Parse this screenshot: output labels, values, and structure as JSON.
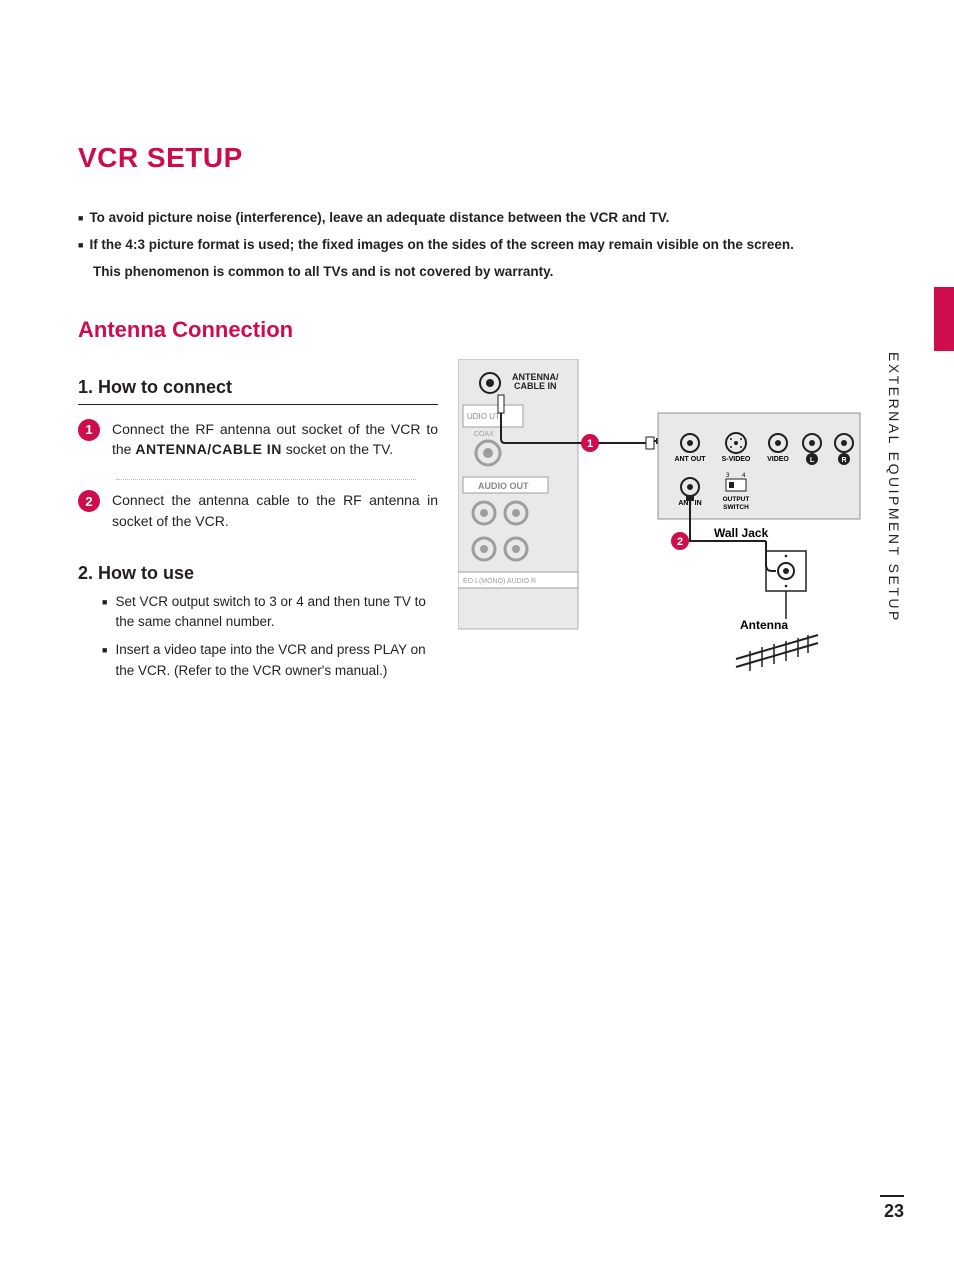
{
  "title": "VCR SETUP",
  "intro": {
    "line1": "To avoid picture noise (interference), leave an adequate distance between the VCR and TV.",
    "line2": "If the 4:3 picture format is used; the fixed images on the sides of the screen may remain visible on the screen.",
    "line2b": "This phenomenon is common to all TVs and is not covered by warranty."
  },
  "section": "Antenna Connection",
  "howconnect": {
    "heading": "1. How to connect",
    "step1_a": "Connect the RF antenna out socket of the VCR to the ",
    "step1_bold": "ANTENNA/CABLE IN",
    "step1_b": " socket on the TV.",
    "step2": "Connect the antenna cable to the RF antenna in socket of the VCR."
  },
  "howuse": {
    "heading": "2. How to use",
    "item1": "Set VCR output switch to 3 or 4 and then tune TV to the same channel number.",
    "item2": "Insert a video tape into the VCR and press PLAY on the VCR. (Refer to the VCR owner's manual.)"
  },
  "diagram": {
    "tv_label1": "ANTENNA/",
    "tv_label2": "CABLE IN",
    "audio_out_label": "AUDIO OUT",
    "udio_ut": "UDIO   UT",
    "coax": "COAX",
    "bottom_row": "EO  L(MONO) AUDIO R",
    "ant_out": "ANT OUT",
    "svideo": "S-VIDEO",
    "video": "VIDEO",
    "l": "L",
    "r": "R",
    "ant_in": "ANT IN",
    "output_switch1": "OUTPUT",
    "output_switch2": "SWITCH",
    "wall_jack": "Wall Jack",
    "antenna": "Antenna",
    "b1": "1",
    "b2": "2"
  },
  "side_label": "EXTERNAL EQUIPMENT SETUP",
  "page_number": "23"
}
